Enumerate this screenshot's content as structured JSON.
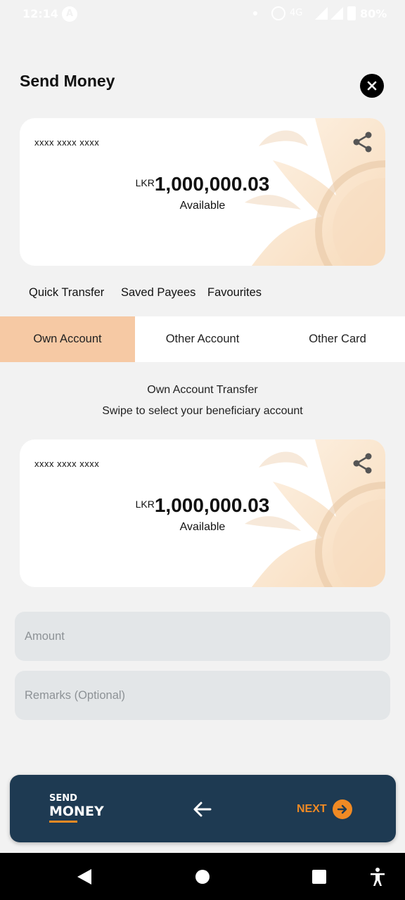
{
  "status_bar": {
    "time": "12:14",
    "badge": "A",
    "network": "4G",
    "battery": "80%"
  },
  "header": {
    "title": "Send Money",
    "close_icon": "close-icon"
  },
  "source_card": {
    "number": "xxxx xxxx xxxx",
    "currency": "LKR",
    "amount": "1,000,000.03",
    "available_label": "Available",
    "share_icon": "share-icon"
  },
  "transfer_types": [
    "Quick Transfer",
    "Saved Payees",
    "Favourites"
  ],
  "account_tabs": [
    {
      "label": "Own Account",
      "active": true
    },
    {
      "label": "Other Account",
      "active": false
    },
    {
      "label": "Other Card",
      "active": false
    }
  ],
  "transfer": {
    "title": "Own Account Transfer",
    "subtitle": "Swipe to select your beneficiary account"
  },
  "beneficiary_card": {
    "number": "xxxx xxxx xxxx",
    "currency": "LKR",
    "amount": "1,000,000.03",
    "available_label": "Available",
    "share_icon": "share-icon"
  },
  "form": {
    "amount_placeholder": "Amount",
    "remarks_placeholder": "Remarks (Optional)"
  },
  "bottom_bar": {
    "brand_line1": "SEND",
    "brand_line2": "MONEY",
    "next_label": "NEXT"
  },
  "colors": {
    "accent": "#f08a24",
    "active_tab": "#f6c9a4",
    "bottom_bar": "#1e3a52",
    "background": "#f2f2f2"
  }
}
